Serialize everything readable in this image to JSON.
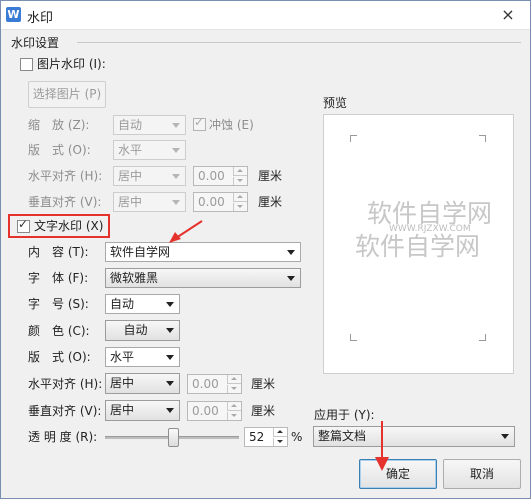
{
  "window": {
    "title": "水印",
    "app_icon": "W"
  },
  "section": {
    "label": "水印设置"
  },
  "picture": {
    "checkbox_label": "图片水印 (I):",
    "select_button": "选择图片 (P)",
    "scale_label": "缩　放 (Z):",
    "scale_value": "自动",
    "washout_label": "冲蚀 (E)",
    "washout_mark": "✓",
    "layout_label": "版　式 (O):",
    "layout_value": "水平",
    "halign_label": "水平对齐 (H):",
    "halign_value": "居中",
    "halign_offset": "0.00",
    "valign_label": "垂直对齐 (V):",
    "valign_value": "居中",
    "valign_offset": "0.00",
    "unit": "厘米"
  },
  "text": {
    "checkbox_label": "文字水印 (X)",
    "check_mark": "✓",
    "content_label": "内　容 (T):",
    "content_value": "软件自学网",
    "font_label": "字　体 (F):",
    "font_value": "微软雅黑",
    "size_label": "字　号 (S):",
    "size_value": "自动",
    "color_label": "颜　色 (C):",
    "color_value": "自动",
    "layout_label": "版　式 (O):",
    "layout_value": "水平",
    "halign_label": "水平对齐 (H):",
    "halign_value": "居中",
    "halign_offset": "0.00",
    "valign_label": "垂直对齐 (V):",
    "valign_value": "居中",
    "valign_offset": "0.00",
    "unit": "厘米",
    "transparency_label": "透 明 度 (R):",
    "transparency_value": "52",
    "transparency_unit": "%"
  },
  "preview": {
    "label": "预览",
    "watermark_text": "软件自学网",
    "watermark_url": "WWW.RJZXW.COM",
    "watermark_text_2": "软件自学网"
  },
  "apply": {
    "label": "应用于 (Y):",
    "value": "整篇文档"
  },
  "buttons": {
    "ok": "确定",
    "cancel": "取消"
  },
  "icons": {
    "close": "×"
  },
  "colors": {
    "highlight": "#e5322d",
    "app_icon": "#3a7bd5"
  }
}
